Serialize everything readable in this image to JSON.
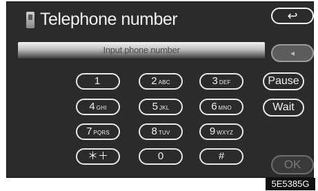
{
  "screen": {
    "title": "Telephone number",
    "back_label": "↩",
    "input_placeholder": "Input phone number",
    "delete_label": "◂",
    "ok_label": "OK"
  },
  "keypad": {
    "keys": [
      {
        "digit": "1",
        "letters": ""
      },
      {
        "digit": "2",
        "letters": "ABC"
      },
      {
        "digit": "3",
        "letters": "DEF"
      },
      {
        "digit": "4",
        "letters": "GHI"
      },
      {
        "digit": "5",
        "letters": "JKL"
      },
      {
        "digit": "6",
        "letters": "MNO"
      },
      {
        "digit": "7",
        "letters": "PQRS"
      },
      {
        "digit": "8",
        "letters": "TUV"
      },
      {
        "digit": "9",
        "letters": "WXYZ"
      },
      {
        "digit": "＊＋",
        "letters": ""
      },
      {
        "digit": "0",
        "letters": ""
      },
      {
        "digit": "#",
        "letters": ""
      }
    ],
    "pause_label": "Pause",
    "wait_label": "Wait"
  },
  "figure_code": "5E5385G"
}
